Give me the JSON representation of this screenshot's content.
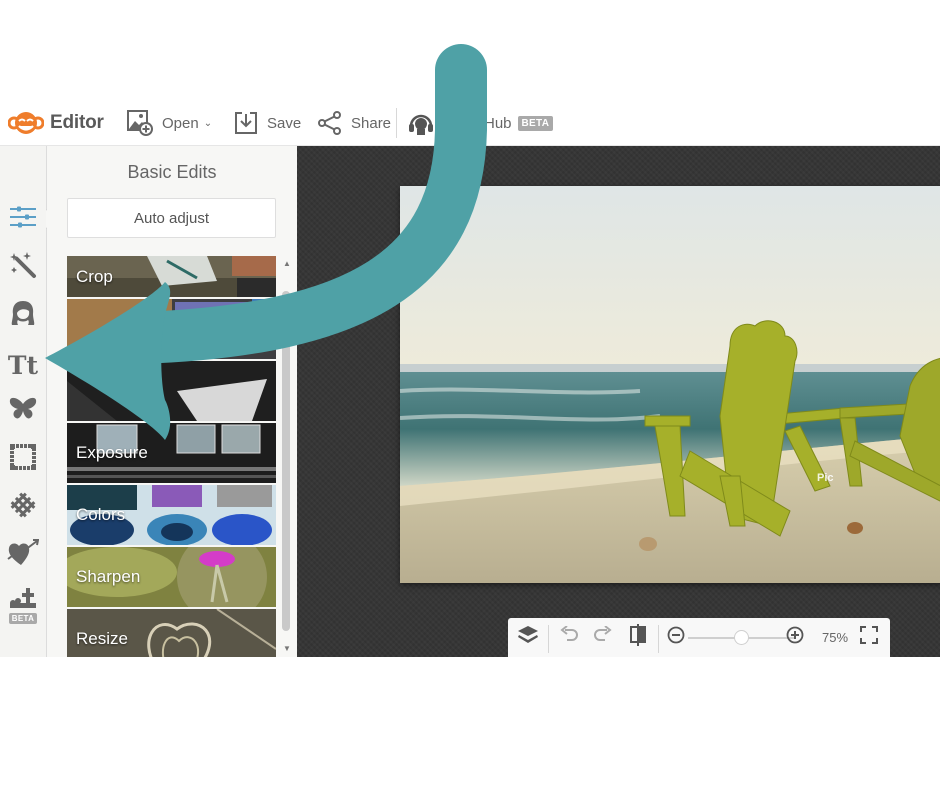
{
  "header": {
    "app_name": "Editor",
    "open_label": "Open",
    "save_label": "Save",
    "share_label": "Share",
    "hub_label": "Hub",
    "hub_badge": "BETA"
  },
  "rail": {
    "items": [
      {
        "name": "basic-edits",
        "icon": "sliders-icon",
        "active": true
      },
      {
        "name": "effects",
        "icon": "magic-wand-icon"
      },
      {
        "name": "touch-up",
        "icon": "face-icon"
      },
      {
        "name": "text",
        "icon": "text-tt-icon"
      },
      {
        "name": "overlays",
        "icon": "butterfly-icon"
      },
      {
        "name": "frames",
        "icon": "frame-icon"
      },
      {
        "name": "textures",
        "icon": "texture-grid-icon"
      },
      {
        "name": "themes",
        "icon": "heart-arrow-icon"
      },
      {
        "name": "extras",
        "icon": "graveyard-icon",
        "badge": "BETA"
      }
    ],
    "beta_badge": "BETA",
    "accent_color": "#5b9fc7"
  },
  "panel": {
    "title": "Basic Edits",
    "auto_adjust_label": "Auto adjust",
    "tiles": [
      {
        "label": "Crop"
      },
      {
        "label": ""
      },
      {
        "label": ""
      },
      {
        "label": "Exposure"
      },
      {
        "label": "Colors"
      },
      {
        "label": "Sharpen"
      },
      {
        "label": "Resize"
      }
    ]
  },
  "canvas": {
    "watermark": "Pic",
    "zoom_level": "75%",
    "zoom_fraction": 0.5
  },
  "colors": {
    "arrow": "#4fa1a6",
    "canvas_bg": "#363636",
    "logo_orange": "#ef7d2b"
  }
}
